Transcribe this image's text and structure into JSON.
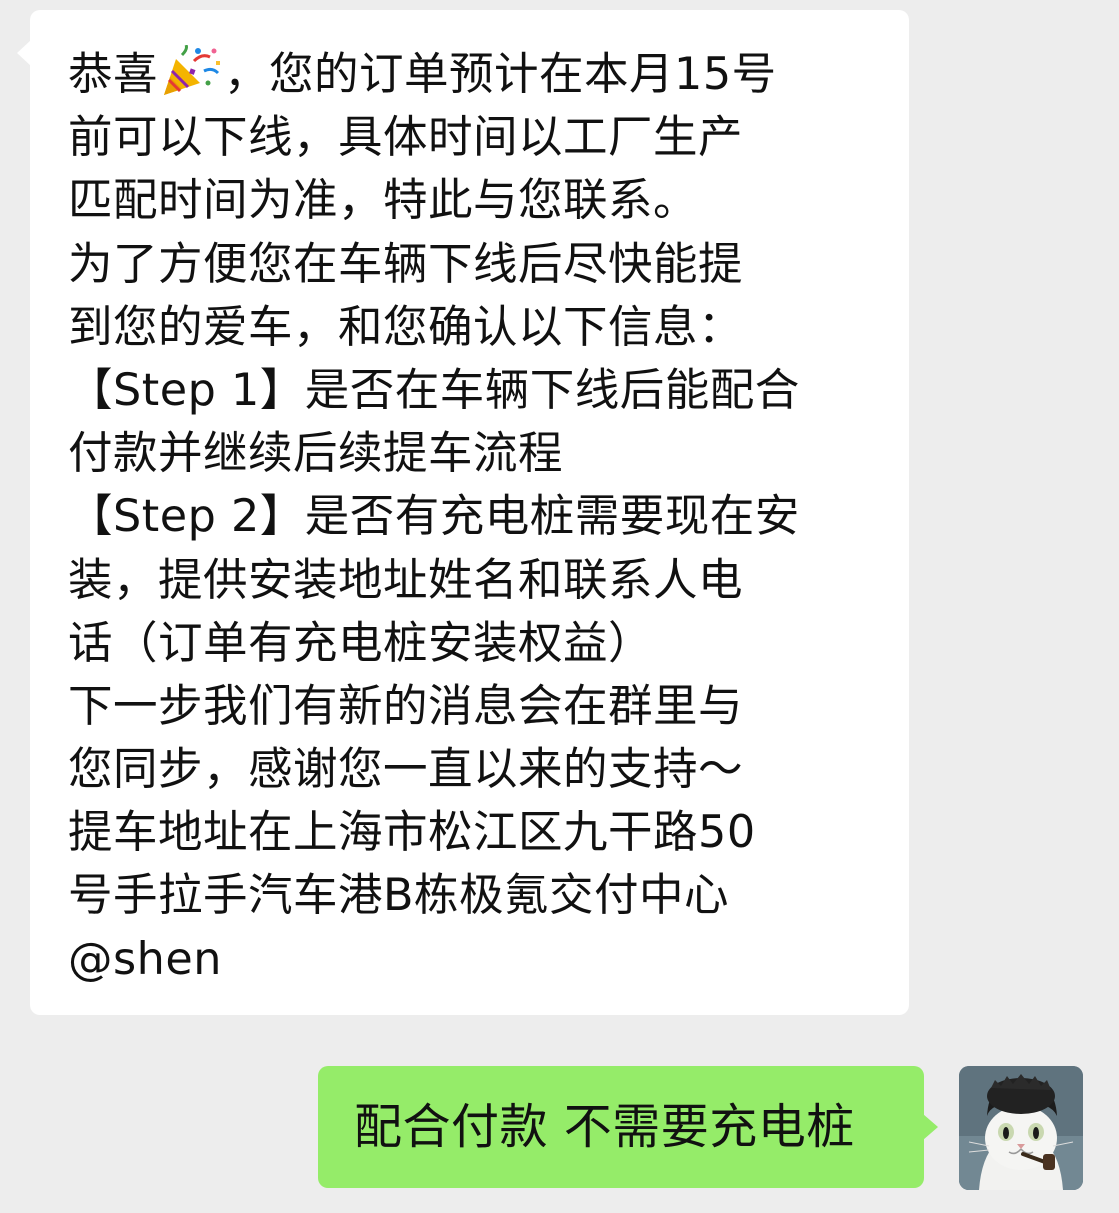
{
  "chat": {
    "incoming": {
      "lines": [
        {
          "before": "恭喜",
          "icon": "party-popper-icon",
          "after": "，您的订单预计在本月15号"
        },
        {
          "text": "前可以下线，具体时间以工厂生产"
        },
        {
          "text": "匹配时间为准，特此与您联系。"
        },
        {
          "text": "为了方便您在车辆下线后尽快能提"
        },
        {
          "text": "到您的爱车，和您确认以下信息："
        },
        {
          "text": "【Step 1】是否在车辆下线后能配合"
        },
        {
          "text": "付款并继续后续提车流程"
        },
        {
          "text": "【Step 2】是否有充电桩需要现在安"
        },
        {
          "text": "装，提供安装地址姓名和联系人电"
        },
        {
          "text": "话（订单有充电桩安装权益）"
        },
        {
          "text": "下一步我们有新的消息会在群里与"
        },
        {
          "text": "您同步，感谢您一直以来的支持～"
        },
        {
          "text": "提车地址在上海市松江区九干路50"
        },
        {
          "text": "号手拉手汽车港B栋极氪交付中心"
        },
        {
          "text": "@shen"
        }
      ]
    },
    "outgoing": {
      "text": "配合付款 不需要充电桩"
    },
    "colors": {
      "background": "#ededed",
      "incoming_bubble": "#ffffff",
      "outgoing_bubble": "#95ec69",
      "text": "#111111"
    }
  }
}
